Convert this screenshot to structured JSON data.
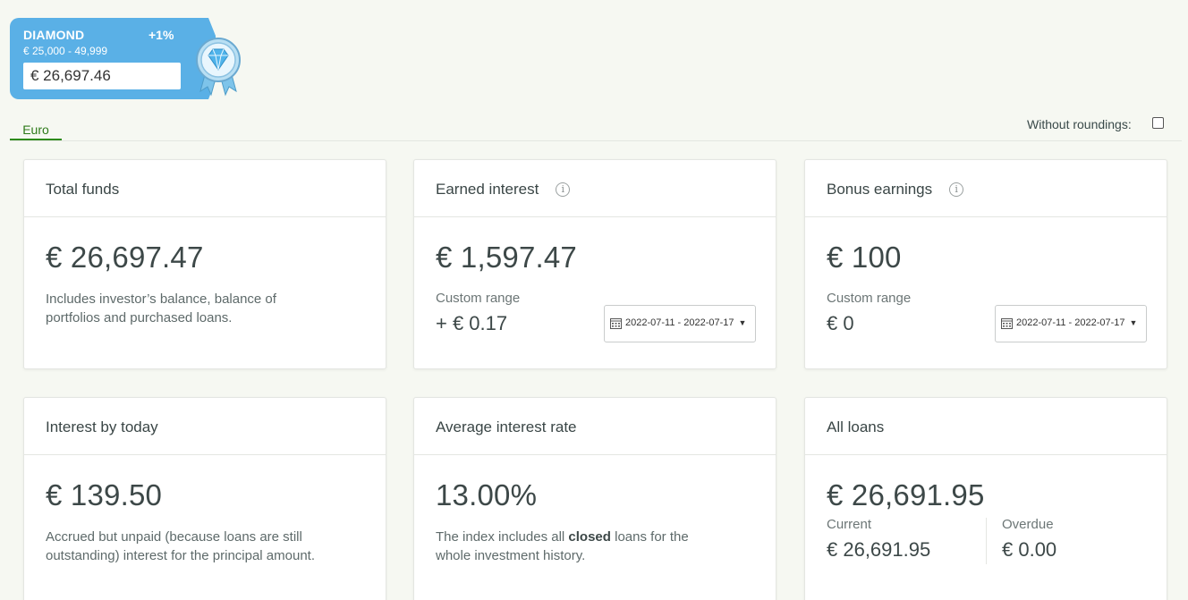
{
  "badge": {
    "level": "DIAMOND",
    "bonus": "+1%",
    "range": "€ 25,000 - 49,999",
    "amount": "€ 26,697.46",
    "color": "#5ab0e6"
  },
  "tabs": {
    "euro": "Euro"
  },
  "options": {
    "without_roundings_label": "Without roundings:",
    "without_roundings_checked": false
  },
  "cards": {
    "total_funds": {
      "title": "Total funds",
      "value": "€ 26,697.47",
      "description": "Includes investor’s balance, balance of portfolios and purchased loans."
    },
    "earned_interest": {
      "title": "Earned interest",
      "value": "€ 1,597.47",
      "range_label": "Custom range",
      "range_value": "+ € 0.17",
      "date_range": "2022-07-11 - 2022-07-17"
    },
    "bonus_earnings": {
      "title": "Bonus earnings",
      "value": "€ 100",
      "range_label": "Custom range",
      "range_value": "€ 0",
      "date_range": "2022-07-11 - 2022-07-17"
    },
    "interest_today": {
      "title": "Interest by today",
      "value": "€ 139.50",
      "description": "Accrued but unpaid (because loans are still outstanding) interest for the principal amount."
    },
    "avg_rate": {
      "title": "Average interest rate",
      "value": "13.00%",
      "description_pre": "The index includes all ",
      "description_bold": "closed",
      "description_post": " loans for the whole investment history."
    },
    "all_loans": {
      "title": "All loans",
      "value": "€ 26,691.95",
      "current_label": "Current",
      "current_value": "€ 26,691.95",
      "overdue_label": "Overdue",
      "overdue_value": "€ 0.00"
    }
  },
  "icons": {
    "info": "info-icon",
    "calendar": "calendar-icon",
    "medal": "diamond-medal-icon"
  }
}
